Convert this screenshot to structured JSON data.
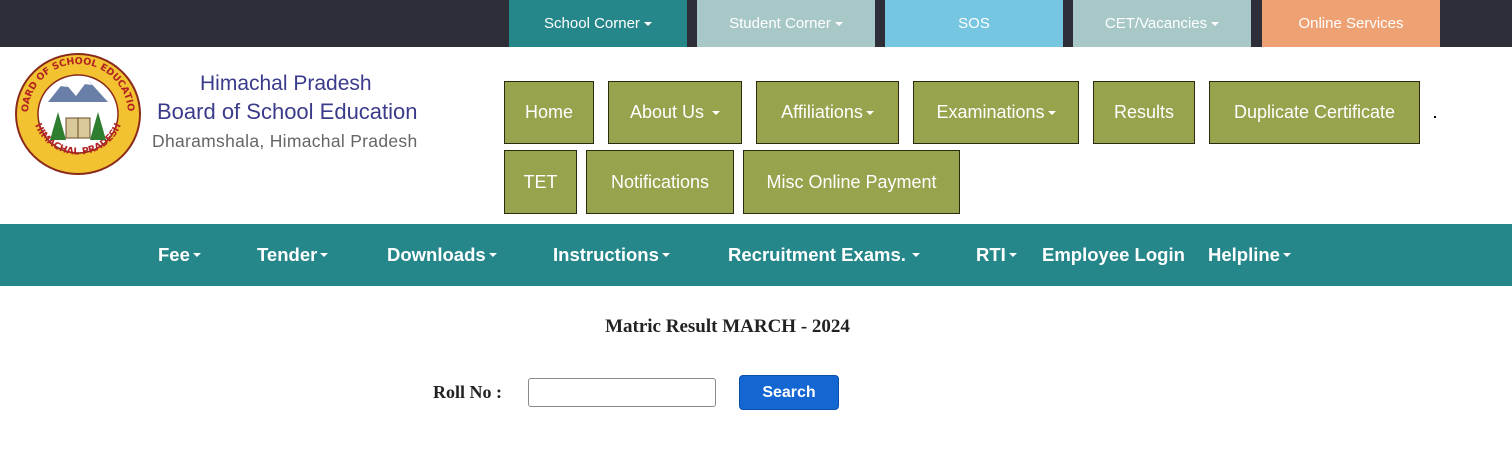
{
  "top_menu": [
    {
      "label": "School Corner",
      "dropdown": true,
      "color": "#26878b"
    },
    {
      "label": "Student Corner",
      "dropdown": true,
      "color": "#a8c8c8"
    },
    {
      "label": "SOS",
      "dropdown": false,
      "color": "#76c6e2"
    },
    {
      "label": "CET/Vacancies",
      "dropdown": true,
      "color": "#a8c8c8"
    },
    {
      "label": "Online Services",
      "dropdown": false,
      "color": "#eea273"
    }
  ],
  "brand": {
    "line1": "Himachal Pradesh",
    "line2": "Board of School Education",
    "line3": "Dharamshala, Himachal Pradesh",
    "logo_text_top": "BOARD OF SCHOOL EDUCATION",
    "logo_text_bottom": "HIMACHAL PRADESH"
  },
  "main_nav": [
    {
      "label": "Home",
      "dropdown": false
    },
    {
      "label": "About Us",
      "dropdown": true
    },
    {
      "label": "Affiliations",
      "dropdown": true
    },
    {
      "label": "Examinations",
      "dropdown": true
    },
    {
      "label": "Results",
      "dropdown": false
    },
    {
      "label": "Duplicate Certificate",
      "dropdown": false
    },
    {
      "label": "TET",
      "dropdown": false
    },
    {
      "label": "Notifications",
      "dropdown": false
    },
    {
      "label": "Misc Online Payment",
      "dropdown": false
    }
  ],
  "secondary_nav": [
    {
      "label": "Fee",
      "dropdown": true
    },
    {
      "label": "Tender",
      "dropdown": true
    },
    {
      "label": "Downloads",
      "dropdown": true
    },
    {
      "label": "Instructions",
      "dropdown": true
    },
    {
      "label": "Recruitment Exams.",
      "dropdown": true
    },
    {
      "label": "RTI",
      "dropdown": true
    },
    {
      "label": "Employee Login",
      "dropdown": false
    },
    {
      "label": "Helpline",
      "dropdown": true
    }
  ],
  "result_form": {
    "title": "Matric Result MARCH - 2024",
    "roll_label": "Roll No :",
    "roll_value": "",
    "search_label": "Search"
  },
  "colors": {
    "nav_button": "#99a24d",
    "teal_bar": "#26878b",
    "search_button": "#1466d2",
    "brand_text": "#3b3b8c"
  }
}
